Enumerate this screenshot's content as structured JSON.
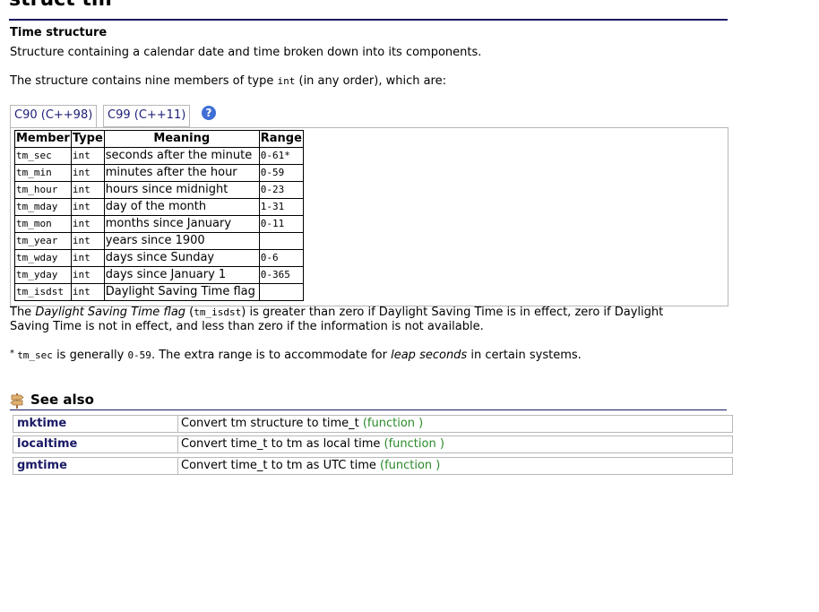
{
  "page": {
    "title": "struct tm",
    "subheading": "Time structure",
    "intro": "Structure containing a calendar date and time broken down into its components.",
    "members_intro_before": "The structure contains nine members of type ",
    "members_intro_code": "int",
    "members_intro_after": " (in any order), which are:"
  },
  "tabs": [
    {
      "label": "C90 (C++98)",
      "active": true
    },
    {
      "label": "C99 (C++11)",
      "active": false
    }
  ],
  "help_icon": "?",
  "table": {
    "headers": [
      "Member",
      "Type",
      "Meaning",
      "Range"
    ],
    "rows": [
      [
        "tm_sec",
        "int",
        "seconds after the minute",
        "0-61*"
      ],
      [
        "tm_min",
        "int",
        "minutes after the hour",
        "0-59"
      ],
      [
        "tm_hour",
        "int",
        "hours since midnight",
        "0-23"
      ],
      [
        "tm_mday",
        "int",
        "day of the month",
        "1-31"
      ],
      [
        "tm_mon",
        "int",
        "months since January",
        "0-11"
      ],
      [
        "tm_year",
        "int",
        "years since 1900",
        ""
      ],
      [
        "tm_wday",
        "int",
        "days since Sunday",
        "0-6"
      ],
      [
        "tm_yday",
        "int",
        "days since January 1",
        "0-365"
      ],
      [
        "tm_isdst",
        "int",
        "Daylight Saving Time flag",
        ""
      ]
    ]
  },
  "dst_note": {
    "t1": "The ",
    "em": "Daylight Saving Time flag",
    "t2": " (",
    "code": "tm_isdst",
    "t3": ") is greater than zero if Daylight Saving Time is in effect, zero if Daylight",
    "line2": "Saving Time is not in effect, and less than zero if the information is not available."
  },
  "footnote": {
    "star": "* ",
    "code1": "tm_sec",
    "t1": " is generally ",
    "code2": "0-59",
    "t2": ". The extra range is to accommodate for ",
    "em": "leap seconds",
    "t3": " in certain systems."
  },
  "see_also": {
    "title": "See also",
    "items": [
      {
        "name": "mktime",
        "desc": "Convert tm structure to time_t ",
        "type": "(function )"
      },
      {
        "name": "localtime",
        "desc": "Convert time_t to tm as local time ",
        "type": "(function )"
      },
      {
        "name": "gmtime",
        "desc": "Convert time_t to tm as UTC time ",
        "type": "(function )"
      }
    ]
  }
}
